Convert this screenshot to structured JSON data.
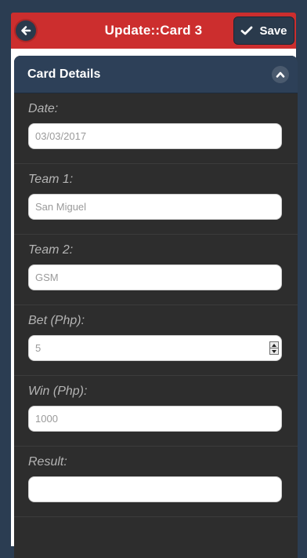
{
  "header": {
    "title": "Update::Card 3",
    "save_label": "Save"
  },
  "card": {
    "title": "Card Details",
    "fields": [
      {
        "label": "Date:",
        "value": "03/03/2017"
      },
      {
        "label": "Team 1:",
        "value": "San Miguel"
      },
      {
        "label": "Team 2:",
        "value": "GSM"
      },
      {
        "label": "Bet (Php):",
        "value": "5"
      },
      {
        "label": "Win (Php):",
        "value": "1000"
      },
      {
        "label": "Result:",
        "value": ""
      }
    ]
  },
  "colors": {
    "header_bg": "#cc2e2e",
    "page_bg": "#2b3d52",
    "card_bg": "#2d2d2d",
    "card_header_bg": "#2d4058",
    "button_bg": "#2a3a4c"
  },
  "icons": {
    "back": "arrow-left-icon",
    "save": "check-icon",
    "collapse": "chevron-up-icon",
    "spinner_up": "caret-up-icon",
    "spinner_down": "caret-down-icon"
  }
}
